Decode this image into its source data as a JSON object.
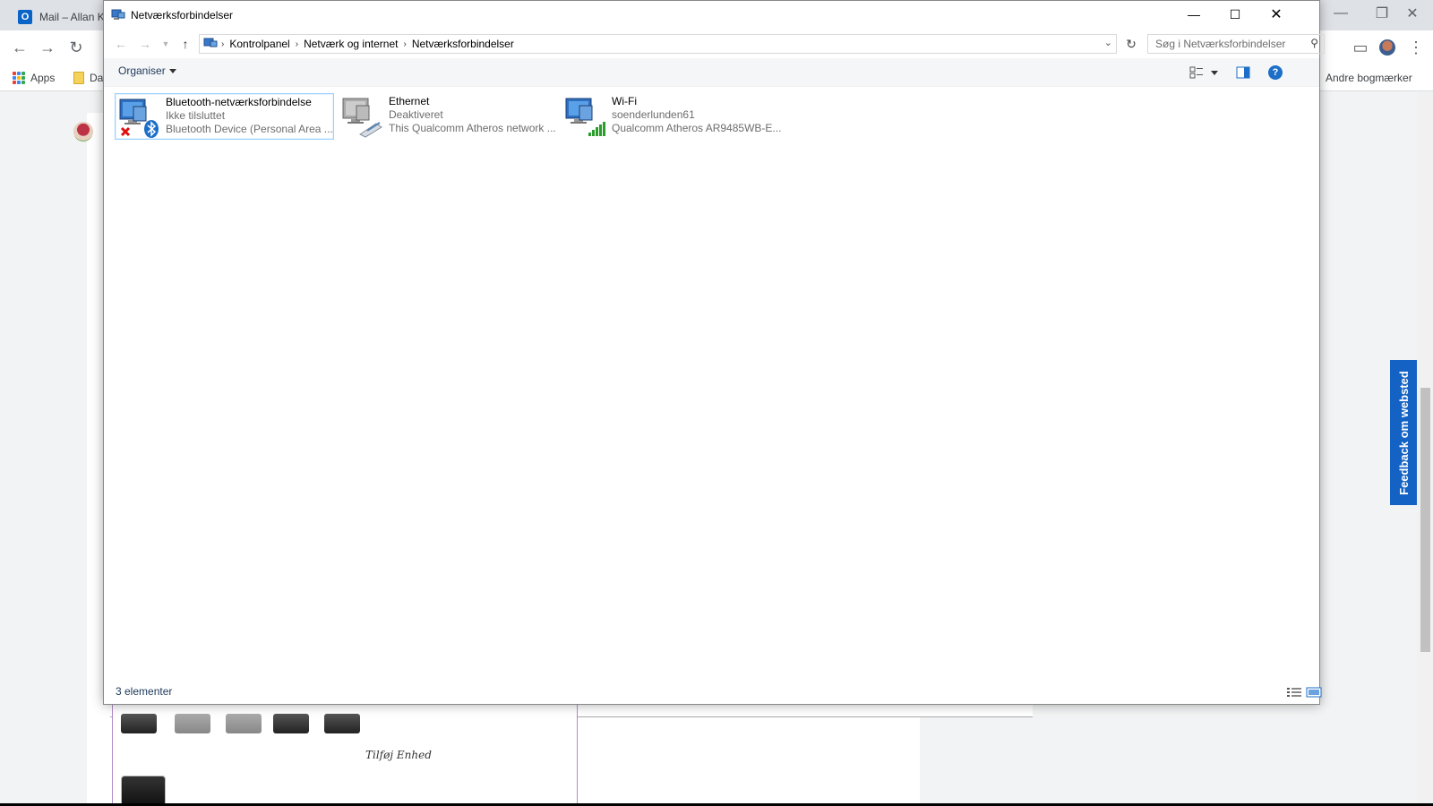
{
  "browser": {
    "tab_title": "Mail – Allan K",
    "bookmarks": [
      {
        "label": "Apps"
      },
      {
        "label": "Da"
      }
    ],
    "other_bookmarks": "Andre bogmærker",
    "feedback_label": "Feedback om websted",
    "page": {
      "tilfoj_label": "Tilføj Enhed"
    }
  },
  "window": {
    "title": "Netværksforbindelser",
    "breadcrumbs": [
      "Kontrolpanel",
      "Netværk og internet",
      "Netværksforbindelser"
    ],
    "search_placeholder": "Søg i Netværksforbindelser",
    "organize_label": "Organiser",
    "connections": [
      {
        "name": "Bluetooth-netværksforbindelse",
        "status": "Ikke tilsluttet",
        "device": "Bluetooth Device (Personal Area ...",
        "icon": "bluetooth-network-icon",
        "selected": true
      },
      {
        "name": "Ethernet",
        "status": "Deaktiveret",
        "device": "This Qualcomm Atheros network ...",
        "icon": "ethernet-network-icon",
        "selected": false
      },
      {
        "name": "Wi-Fi",
        "status": "soenderlunden61",
        "device": "Qualcomm Atheros AR9485WB-E...",
        "icon": "wifi-network-icon",
        "selected": false
      }
    ],
    "status_count": "3 elementer"
  },
  "colors": {
    "accent": "#1463c4",
    "selection_border": "#99d1ff",
    "link_text": "#1e395b"
  }
}
